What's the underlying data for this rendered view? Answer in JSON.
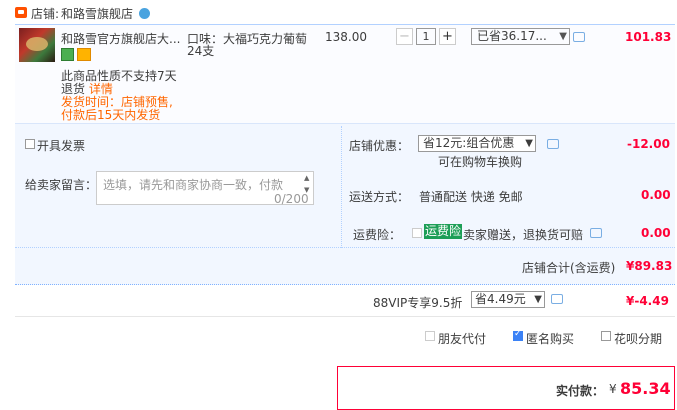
{
  "store": {
    "label": "店铺:",
    "name": "和路雪旗舰店"
  },
  "item": {
    "title": "和路雪官方旗舰店大...",
    "spec_line1": "口味：大福巧克力葡萄",
    "spec_line2": "24支",
    "price": "138.00",
    "qty_minus": "−",
    "qty_value": "1",
    "qty_plus": "+",
    "saved": "已省36.17...",
    "total": "101.83",
    "note1": "此商品性质不支持7天",
    "note2_prefix": "退货",
    "note2_link": "详情",
    "ship_time1": "发货时间：店铺预售,",
    "ship_time2": "付款后15天内发货"
  },
  "options": {
    "invoice_label": "开具发票",
    "message_label": "给卖家留言：",
    "message_placeholder": "选填，请先和商家协商一致，付款",
    "message_count": "0/200",
    "discount_label": "店铺优惠：",
    "discount_selected": "省12元:组合优惠",
    "discount_sub": "可在购物车换购",
    "discount_value": "-12.00",
    "shipping_label": "运送方式：",
    "shipping_method": "普通配送 快递 免邮",
    "shipping_value": "0.00",
    "insurance_label": "运费险：",
    "insurance_tag": "运费险",
    "insurance_text": "卖家赠送，退换货可赔",
    "insurance_value": "0.00",
    "store_total_label": "店铺合计(含运费)",
    "store_total_value": "¥89.83"
  },
  "vip": {
    "label": "88VIP专享9.5折",
    "selected": "省4.49元",
    "value": "¥-4.49"
  },
  "payment": {
    "opt1": "朋友代付",
    "opt2": "匿名购买",
    "opt3": "花呗分期"
  },
  "final": {
    "label": "实付款：",
    "currency": "¥",
    "value": "85.34"
  },
  "colors": {
    "accent": "#ff0036",
    "orange": "#ff6600",
    "green_tag": "#1d9e57"
  }
}
